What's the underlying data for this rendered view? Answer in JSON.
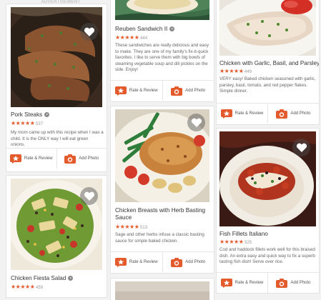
{
  "ad_label": "ADVERTISEMENT",
  "colors": {
    "accent": "#e35b2c",
    "star": "#e35b2c"
  },
  "action_labels": {
    "rate": "Rate & Review",
    "photo": "Add Photo"
  },
  "cards": {
    "pork": {
      "title": "Pork Steaks",
      "stars": "★★★★★",
      "count": "537",
      "desc": "My mom came up with this recipe when I was a child. It is the ONLY way I will eat green onions."
    },
    "fiesta": {
      "title": "Chicken Fiesta Salad",
      "stars": "★★★★★",
      "count": "459"
    },
    "reuben": {
      "title": "Reuben Sandwich II",
      "stars": "★★★★★",
      "count": "444",
      "desc": "These sandwiches are really delicious and easy to make. They are one of my family's fix-it-quick favorites. I like to serve them with big bowls of steaming vegetable soup and dill pickles on the side. Enjoy!"
    },
    "herb": {
      "title": "Chicken Breasts with Herb Basting Sauce",
      "stars": "★★★★★",
      "count": "513",
      "desc": "Sage and other herbs infuse a classic basting sauce for simple baked chicken."
    },
    "garlic": {
      "title": "Chicken with Garlic, Basil, and Parsley",
      "stars": "★★★★★",
      "count": "449",
      "desc": "VERY easy! Baked chicken seasoned with garlic, parsley, basil, tomato, and red pepper flakes. Simple dinner."
    },
    "fish": {
      "title": "Fish Fillets Italiano",
      "stars": "★★★★★",
      "count": "525",
      "desc": "Cod and haddock fillets work well for this braised dish. An extra easy and quick way to fix a superb tasting fish dish! Serve over rice."
    }
  }
}
